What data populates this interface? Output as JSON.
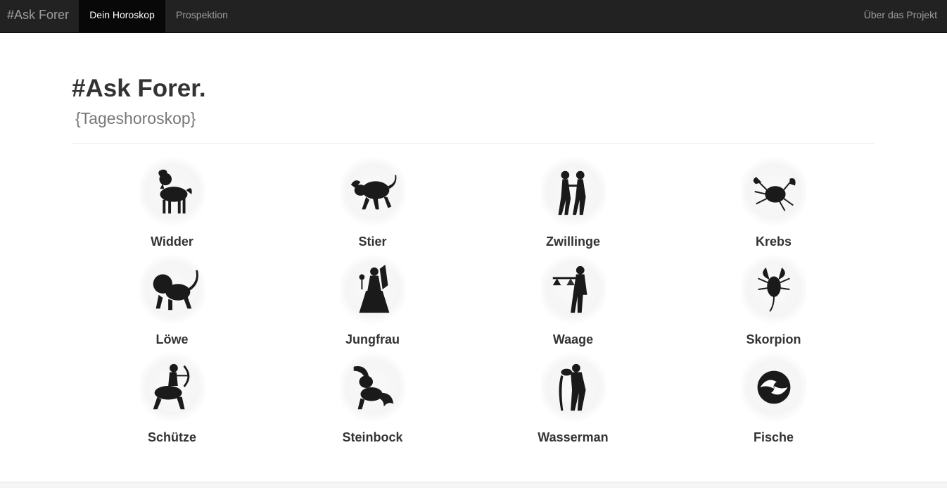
{
  "navbar": {
    "brand": "#Ask Forer",
    "items": [
      {
        "label": "Dein Horoskop",
        "active": true
      },
      {
        "label": "Prospektion",
        "active": false
      }
    ],
    "right_item": "Über das Projekt"
  },
  "header": {
    "title": "#Ask Forer.",
    "subtitle": "{Tageshoroskop}"
  },
  "signs": [
    {
      "label": "Widder",
      "icon": "aries-ram-icon"
    },
    {
      "label": "Stier",
      "icon": "taurus-bull-icon"
    },
    {
      "label": "Zwillinge",
      "icon": "gemini-twins-icon"
    },
    {
      "label": "Krebs",
      "icon": "cancer-crab-icon"
    },
    {
      "label": "Löwe",
      "icon": "leo-lion-icon"
    },
    {
      "label": "Jungfrau",
      "icon": "virgo-maiden-icon"
    },
    {
      "label": "Waage",
      "icon": "libra-scales-icon"
    },
    {
      "label": "Skorpion",
      "icon": "scorpio-scorpion-icon"
    },
    {
      "label": "Schütze",
      "icon": "sagittarius-archer-icon"
    },
    {
      "label": "Steinbock",
      "icon": "capricorn-goat-icon"
    },
    {
      "label": "Wasserman",
      "icon": "aquarius-waterbearer-icon"
    },
    {
      "label": "Fische",
      "icon": "pisces-fish-icon"
    }
  ],
  "colors": {
    "navbar_bg": "#222222",
    "navbar_active_bg": "#080808",
    "nav_text": "#9d9d9d",
    "icon_fill": "#1a1a1a"
  }
}
